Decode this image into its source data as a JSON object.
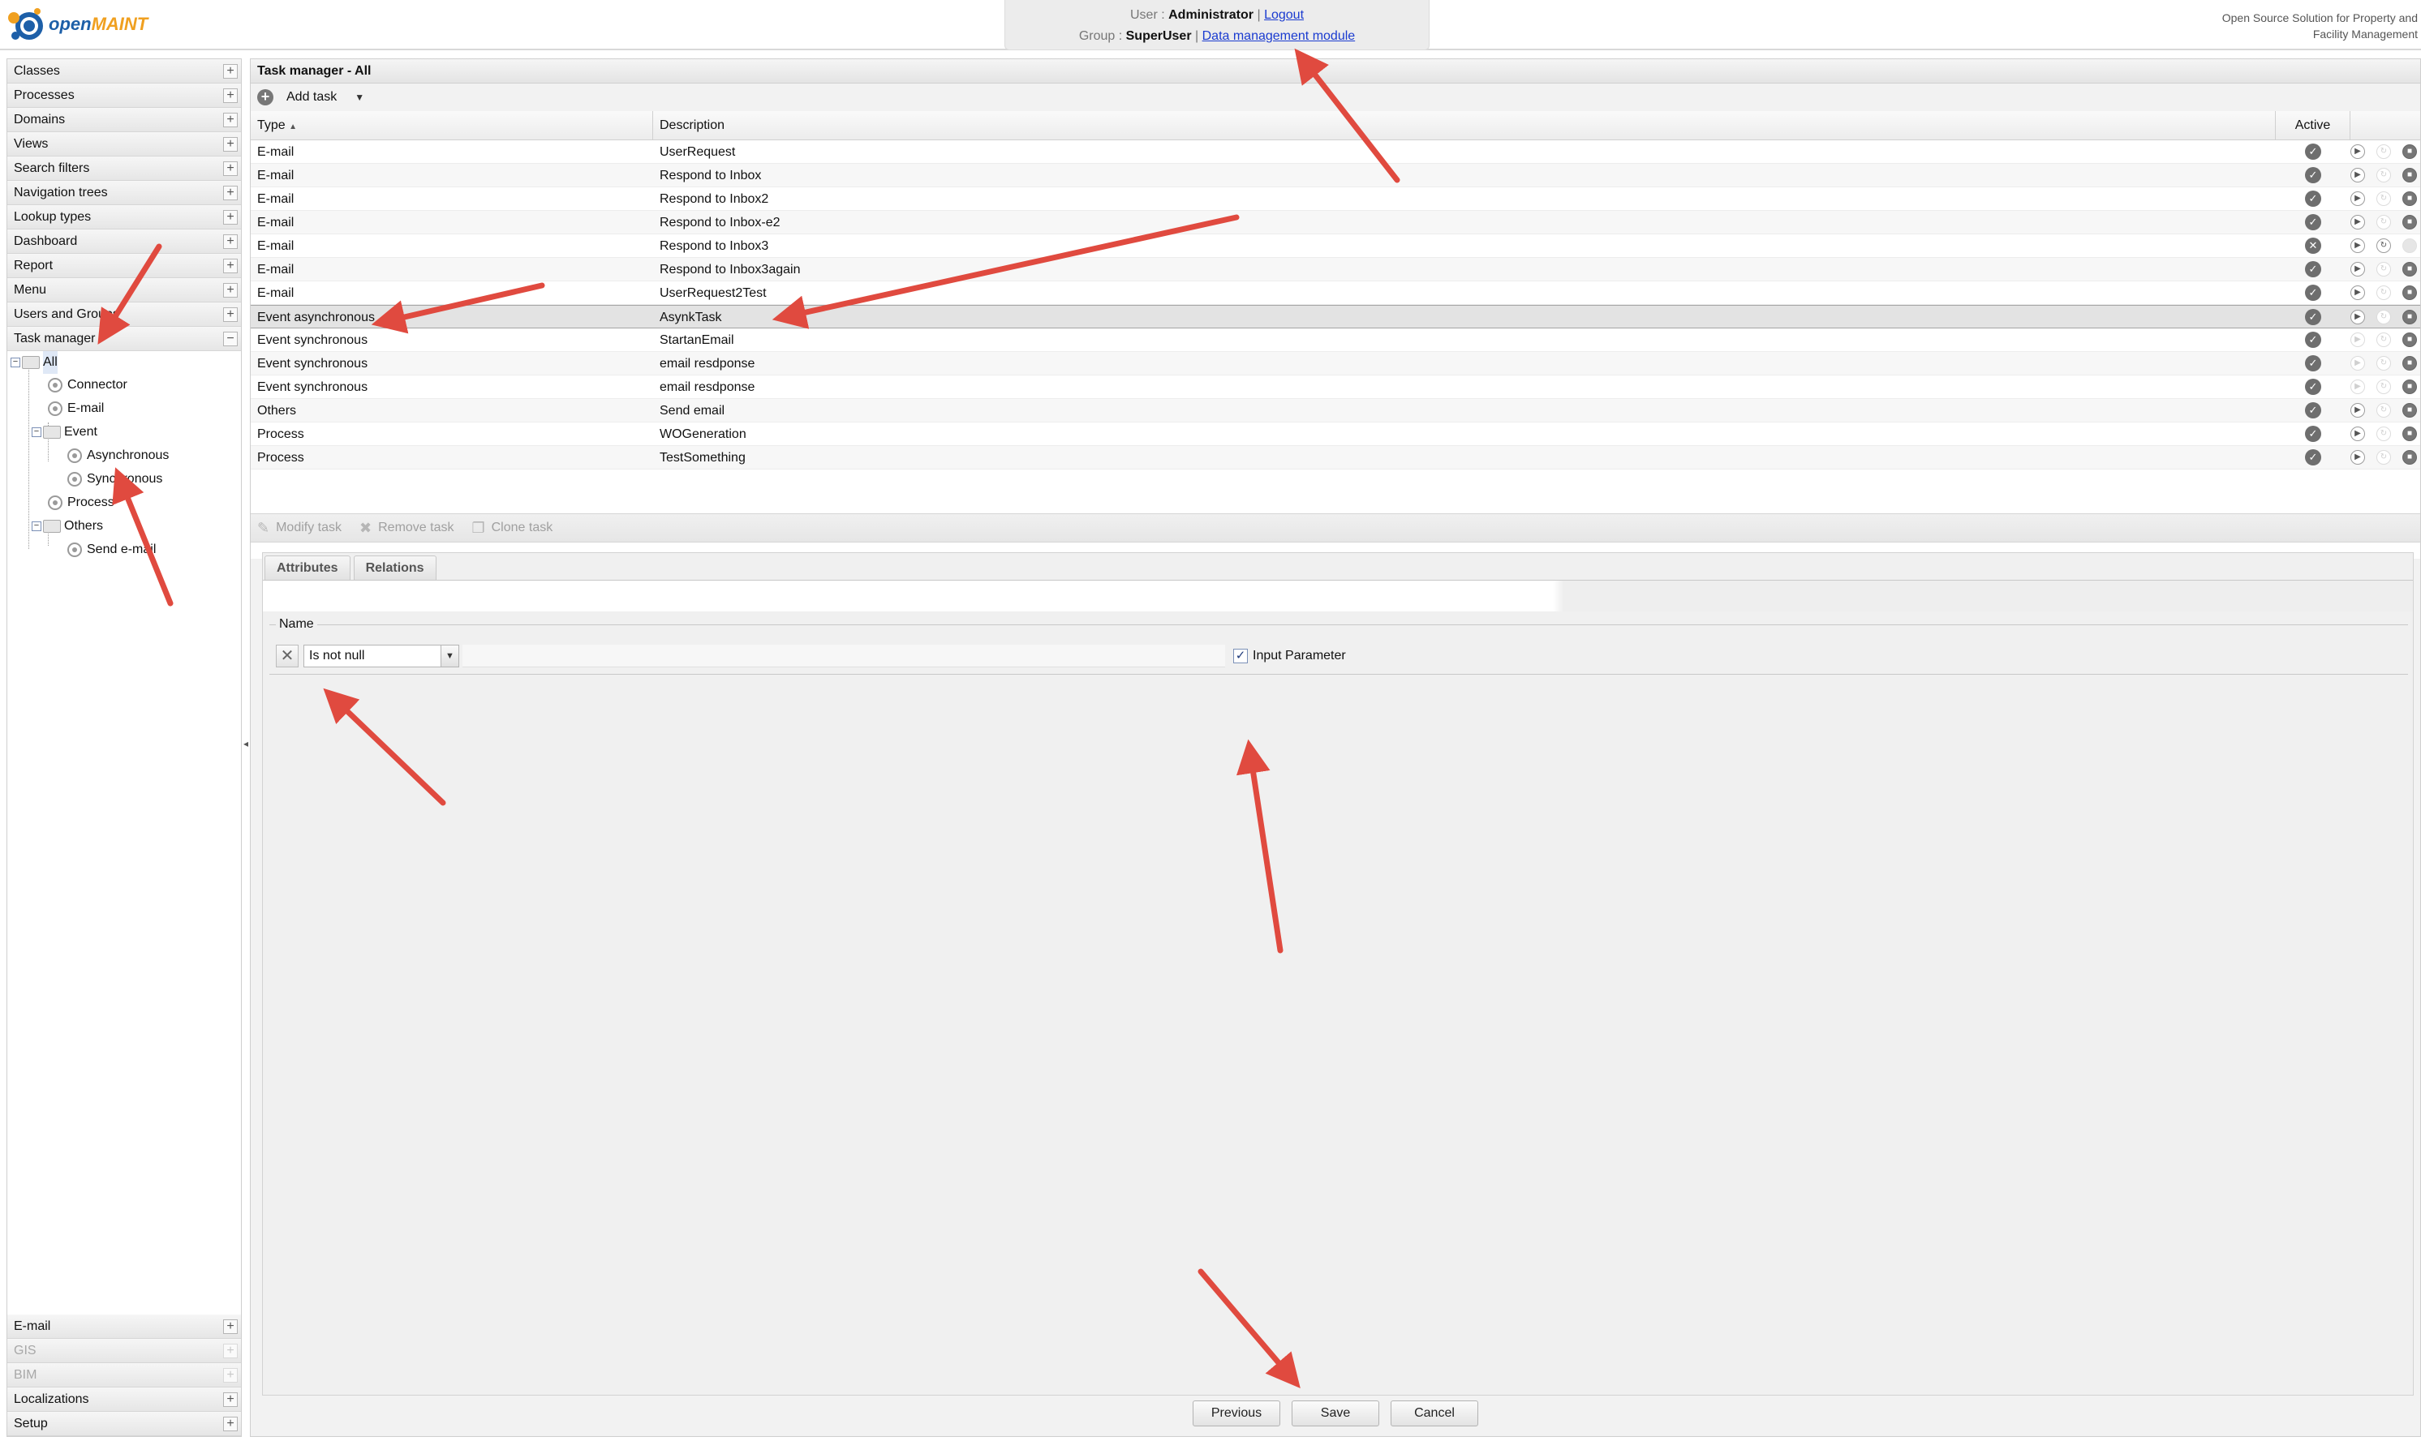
{
  "header": {
    "logo_open": "open",
    "logo_maint": "MAINT",
    "user_label": "User :",
    "user_name": "Administrator",
    "logout": "Logout",
    "group_label": "Group :",
    "group_name": "SuperUser",
    "module_link": "Data management module",
    "tagline_1": "Open Source Solution for Property and",
    "tagline_2": "Facility Management"
  },
  "sidebar": {
    "top_items": [
      "Classes",
      "Processes",
      "Domains",
      "Views",
      "Search filters",
      "Navigation trees",
      "Lookup types",
      "Dashboard",
      "Report",
      "Menu",
      "Users and Groups",
      "Task manager"
    ],
    "tree": {
      "all": "All",
      "connector": "Connector",
      "email": "E-mail",
      "event": "Event",
      "asynchronous": "Asynchronous",
      "synchronous": "Synchronous",
      "process": "Process",
      "others": "Others",
      "send_email": "Send e-mail"
    },
    "bottom_items": [
      {
        "label": "E-mail",
        "disabled": false
      },
      {
        "label": "GIS",
        "disabled": true
      },
      {
        "label": "BIM",
        "disabled": true
      },
      {
        "label": "Localizations",
        "disabled": false
      },
      {
        "label": "Setup",
        "disabled": false
      }
    ]
  },
  "main": {
    "title": "Task manager - All",
    "add_task": "Add task",
    "columns": {
      "type": "Type",
      "description": "Description",
      "active": "Active"
    },
    "rows": [
      {
        "type": "E-mail",
        "description": "UserRequest",
        "active": true
      },
      {
        "type": "E-mail",
        "description": "Respond to Inbox",
        "active": true
      },
      {
        "type": "E-mail",
        "description": "Respond to Inbox2",
        "active": true
      },
      {
        "type": "E-mail",
        "description": "Respond to Inbox-e2",
        "active": true
      },
      {
        "type": "E-mail",
        "description": "Respond to Inbox3",
        "active": false
      },
      {
        "type": "E-mail",
        "description": "Respond to Inbox3again",
        "active": true
      },
      {
        "type": "E-mail",
        "description": "UserRequest2Test",
        "active": true
      },
      {
        "type": "Event asynchronous",
        "description": "AsynkTask",
        "active": true,
        "selected": true
      },
      {
        "type": "Event synchronous",
        "description": "StartanEmail",
        "active": true
      },
      {
        "type": "Event synchronous",
        "description": "email resdponse",
        "active": true
      },
      {
        "type": "Event synchronous",
        "description": "email resdponse",
        "active": true
      },
      {
        "type": "Others",
        "description": "Send email",
        "active": true
      },
      {
        "type": "Process",
        "description": "WOGeneration",
        "active": true
      },
      {
        "type": "Process",
        "description": "TestSomething",
        "active": true
      }
    ],
    "task_toolbar": {
      "modify": "Modify task",
      "remove": "Remove task",
      "clone": "Clone task"
    },
    "tabs": [
      "Attributes",
      "Relations"
    ],
    "filter": {
      "legend": "Name",
      "operator": "Is not null",
      "input_parameter": "Input Parameter",
      "input_parameter_checked": true
    },
    "buttons": {
      "previous": "Previous",
      "save": "Save",
      "cancel": "Cancel"
    }
  },
  "colors": {
    "link": "#1a3bd0",
    "annotation_arrow": "#e04a3f",
    "logo_blue": "#1d5fa8",
    "logo_orange": "#f0a020"
  }
}
